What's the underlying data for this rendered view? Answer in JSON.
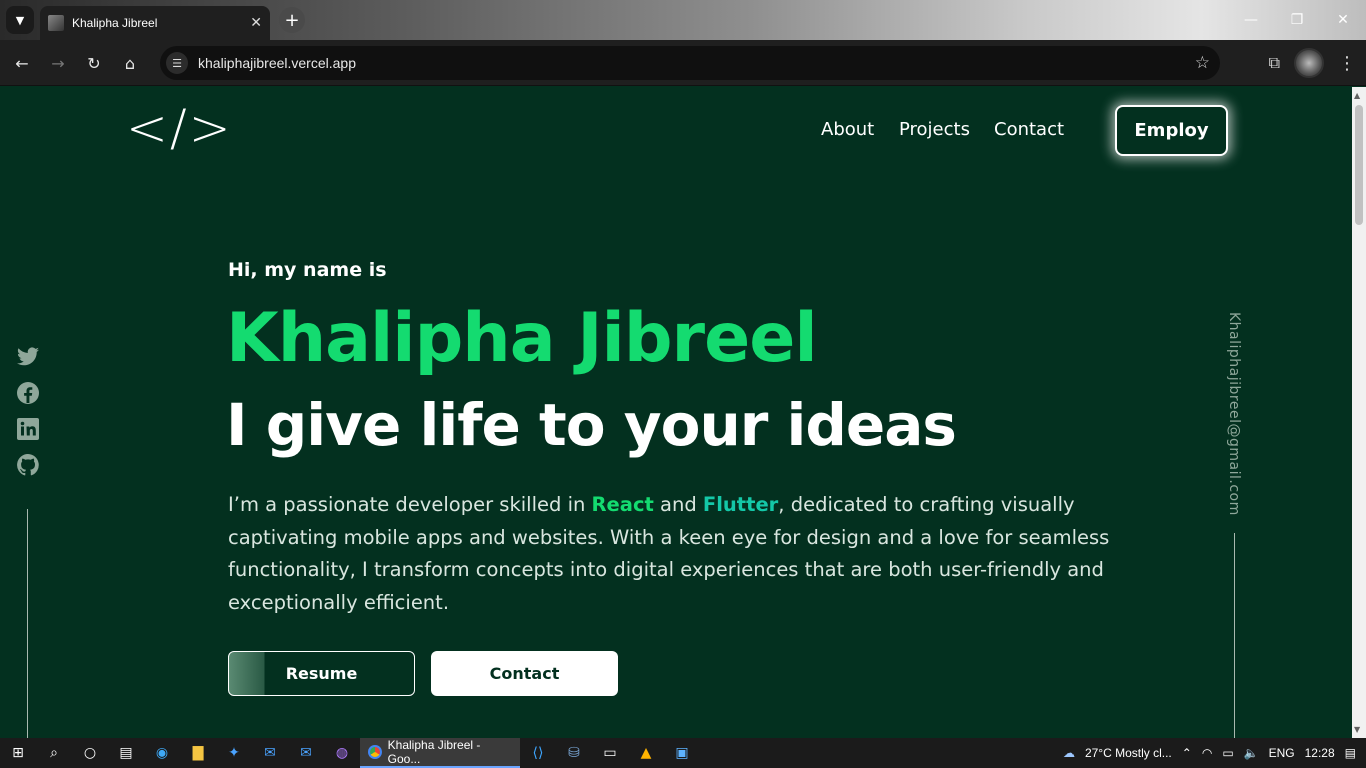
{
  "browser": {
    "tab_title": "Khalipha Jibreel",
    "url": "khaliphajibreel.vercel.app",
    "close_tab_glyph": "✕",
    "new_tab_glyph": "+"
  },
  "site": {
    "logo_text": "</>",
    "nav": {
      "about": "About",
      "projects": "Projects",
      "contact": "Contact",
      "employ": "Employ"
    },
    "hero": {
      "greeting": "Hi, my name is",
      "name": "Khalipha Jibreel",
      "tagline": "I give life to your ideas",
      "bio_part1": "I’m a passionate developer skilled in ",
      "bio_react": "React",
      "bio_and": " and ",
      "bio_flutter": "Flutter",
      "bio_part2": ", dedicated to crafting visually captivating mobile apps and websites. With a keen eye for design and a love for seamless functionality, I transform concepts into digital experiences that are both user-friendly and exceptionally efficient.",
      "resume_button": "Resume",
      "contact_button": "Contact"
    },
    "email": "Khaliphajibreel@gmail.com",
    "social_icons": [
      "twitter-icon",
      "facebook-icon",
      "linkedin-icon",
      "github-icon"
    ]
  },
  "taskbar": {
    "active_app": "Khalipha Jibreel - Goo...",
    "weather": "27°C  Mostly cl...",
    "language": "ENG",
    "time": "12:28"
  }
}
